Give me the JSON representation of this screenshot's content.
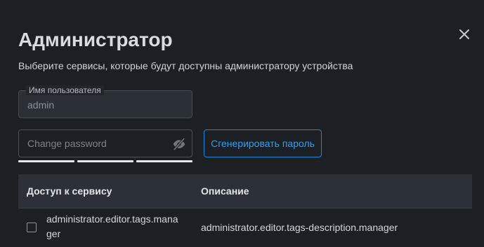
{
  "dialog": {
    "title": "Администратор",
    "subtitle": "Выберите сервисы, которые будут доступны администратору устройства",
    "close_icon": "close-icon"
  },
  "username_field": {
    "label": "Имя пользователя",
    "value": "admin"
  },
  "password_field": {
    "placeholder": "Change password",
    "value": "",
    "visibility_icon": "eye-off-icon",
    "strength_segments_filled": 3,
    "strength_segments_total": 3
  },
  "generate_button": {
    "label": "Сгенерировать пароль"
  },
  "table": {
    "columns": [
      "Доступ к сервису",
      "Описание"
    ],
    "rows": [
      {
        "checked": false,
        "service": "administrator.editor.tags.manager",
        "description": "administrator.editor.tags-description.manager"
      }
    ]
  },
  "colors": {
    "background": "#1c1f24",
    "accent": "#2ea1f2",
    "text": "#d9dbde",
    "header_bg": "#2c3038"
  }
}
